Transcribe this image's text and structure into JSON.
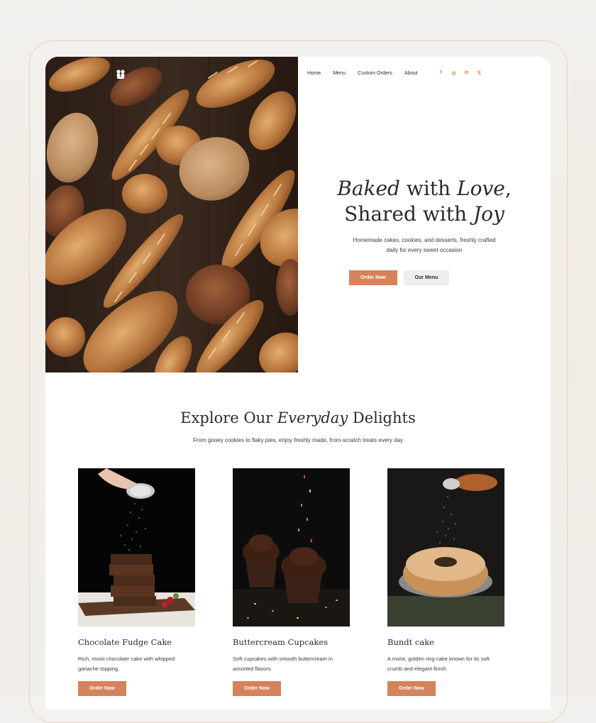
{
  "nav": {
    "items": [
      "Home",
      "Menu",
      "Custom Orders",
      "About"
    ]
  },
  "social": {
    "icons": [
      "facebook-icon",
      "instagram-icon",
      "linkedin-icon",
      "x-icon"
    ],
    "glyphs": [
      "f",
      "◎",
      "in",
      "𝕏"
    ]
  },
  "hero": {
    "title_line1_a": "Baked",
    "title_line1_b": " with ",
    "title_line1_c": "Love",
    "title_line1_d": ",",
    "title_line2_a": "Shared with ",
    "title_line2_b": "Joy",
    "subtitle": "Homemade cakes, cookies, and desserts, freshly crafted daily for every sweet occasion",
    "primary_button": "Order Now",
    "secondary_button": "Our Menu"
  },
  "section": {
    "title_a": "Explore Our ",
    "title_b": "Everyday",
    "title_c": " Delights",
    "subtitle": "From gooey cookies to flaky pies, enjoy freshly made, from-scratch treats every day"
  },
  "cards": [
    {
      "name": "Chocolate Fudge Cake",
      "desc": "Rich, moist chocolate cake with whipped ganache topping.",
      "button": "Order Now"
    },
    {
      "name": "Buttercream Cupcakes",
      "desc": "Soft cupcakes with smooth buttercream in assorted flavors.",
      "button": "Order Now"
    },
    {
      "name": "Bundt cake",
      "desc": "A moist, golden ring cake known for its soft crumb and elegant finish.",
      "button": "Order Now"
    }
  ],
  "colors": {
    "accent": "#d4835a",
    "social": "#d4833f",
    "frame": "#e6d6ba"
  }
}
